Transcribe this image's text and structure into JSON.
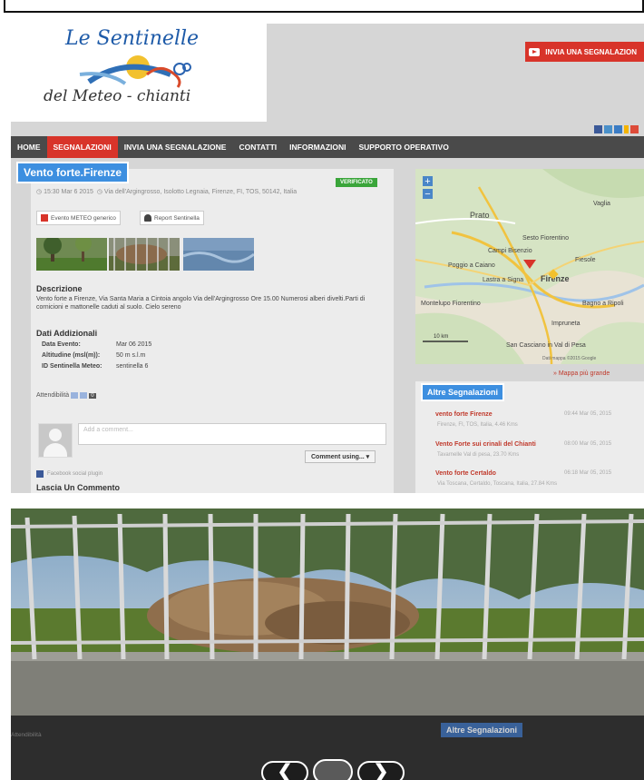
{
  "site": {
    "logo_top": "Le Sentinelle",
    "logo_bottom": "del Meteo - chianti",
    "report_button": "INVIA UNA SEGNALAZION"
  },
  "nav": {
    "items": [
      "HOME",
      "SEGNALAZIONI",
      "INVIA UNA SEGNALAZIONE",
      "CONTATTI",
      "INFORMAZIONI",
      "SUPPORTO OPERATIVO"
    ],
    "active": "SEGNALAZIONI"
  },
  "report": {
    "title": "Vento forte.Firenze",
    "status": "VERIFICATO",
    "time": "15:30 Mar 6 2015",
    "location": "Via dell'Argingrosso, Isolotto Legnaia, Firenze, FI, TOS, 50142, Italia",
    "badge_event": "Evento METEO generico",
    "badge_report": "Report Sentinella",
    "description_heading": "Descrizione",
    "description": "Vento forte a Firenze, Via Santa Maria a Cintoia angolo Via dell'Argingrosso Ore 15.00 Numerosi alberi divelti.Parti di cornicioni e mattonelle caduti al suolo. Cielo sereno",
    "additional_heading": "Dati Addizionali",
    "fields": [
      {
        "label": "Data Evento:",
        "value": "Mar 06 2015"
      },
      {
        "label": "Altitudine (msl(m)):",
        "value": "50 m s.l.m"
      },
      {
        "label": "ID Sentinella Meteo:",
        "value": "sentinella 6"
      }
    ],
    "reliability_label": "Attendibilità",
    "reliability_value": "0"
  },
  "comments": {
    "placeholder": "Add a comment...",
    "comment_using": "Comment using... ▾",
    "plugin": "Facebook social plugin",
    "leave_heading": "Lascia Un Commento"
  },
  "map": {
    "zoom_in": "+",
    "zoom_out": "−",
    "places": [
      "Prato",
      "Sesto Fiorentino",
      "Poggio a Caiano",
      "Firenze",
      "Lastra a Signa",
      "Fiesole",
      "Bagno a Ripoli",
      "Impruneta",
      "San Casciano in Val di Pesa",
      "Montelupo Fiorentino",
      "Vaglia",
      "Campi Bisenzio"
    ],
    "scale": "10 km",
    "attribution": "Dati mappa ©2015 Google",
    "bigger_link": "» Mappa più grande"
  },
  "other_reports": {
    "heading": "Altre Segnalazioni",
    "items": [
      {
        "title": "vento forte Firenze",
        "sub": "Firenze, FI, TOS, Italia, 4.46 Kms",
        "time": "09:44 Mar 05, 2015"
      },
      {
        "title": "Vento Forte sui crinali del Chianti",
        "sub": "Tavarnelle Val di pesa, 23.70 Kms",
        "time": "08:00 Mar 05, 2015"
      },
      {
        "title": "Vento forte Certaldo",
        "sub": "Via Toscana, Certaldo, Toscana, Italia, 27.84 Kms",
        "time": "06:18 Mar 05, 2015"
      }
    ]
  },
  "viewer": {
    "prev": "❮",
    "next": "❯",
    "background_heading": "Altre Segnalazioni",
    "background_text": "Attendibilità"
  },
  "colors": {
    "accent_red": "#d8342a",
    "tag_blue": "#3d8fe0",
    "nav_bg": "#4a4a4a",
    "verified_green": "#3aa53a"
  }
}
